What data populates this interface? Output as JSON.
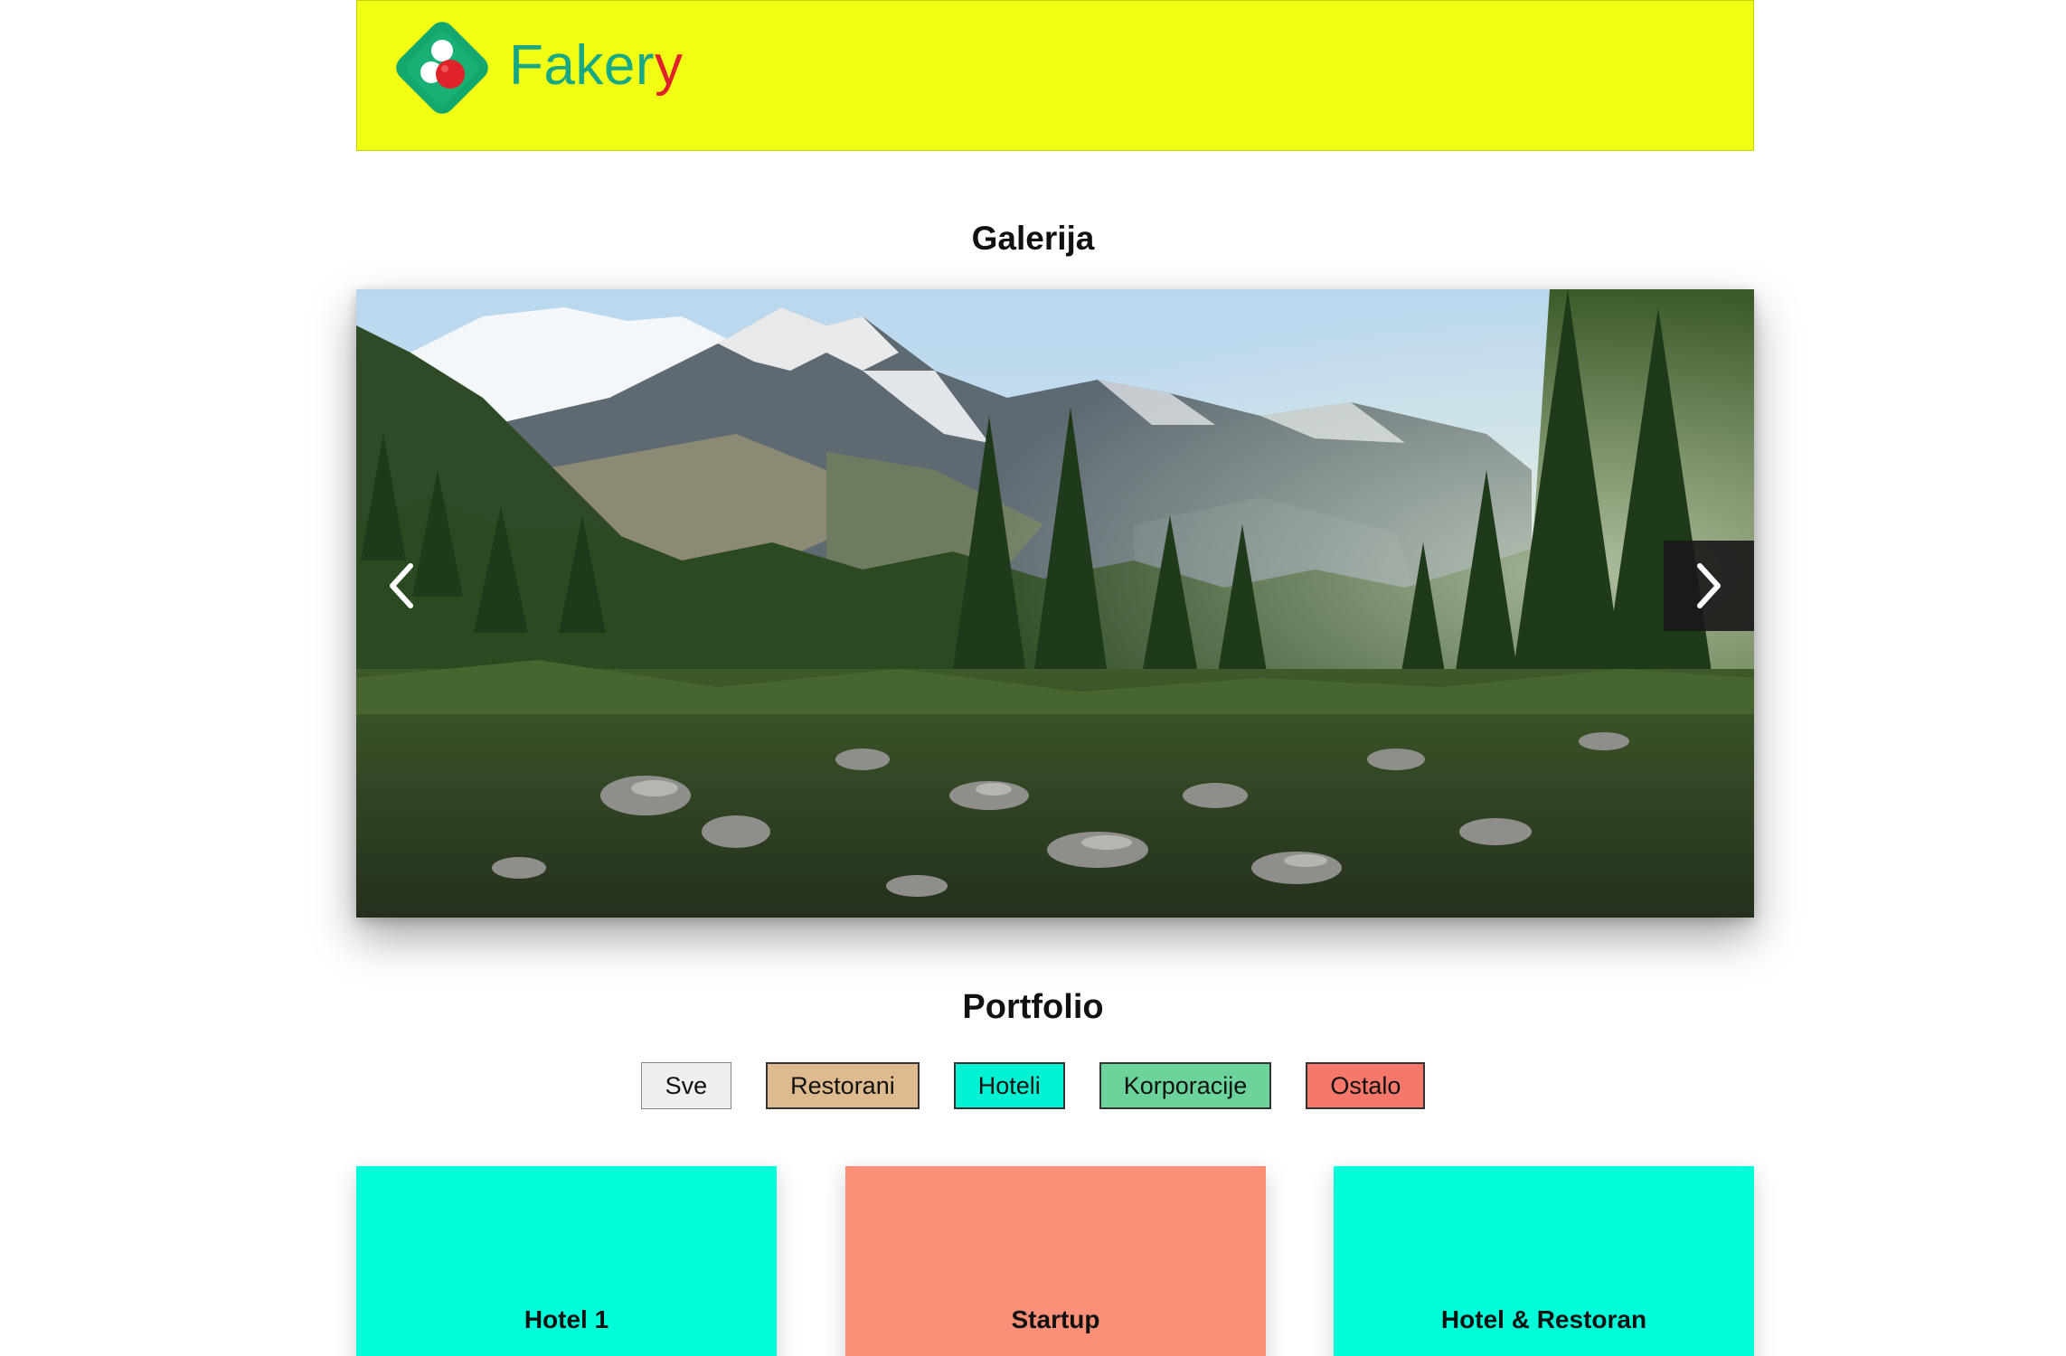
{
  "header": {
    "brand_main": "Faker",
    "brand_accent": "y",
    "colors": {
      "background": "#f1ff14",
      "brand_text": "#19a884",
      "brand_accent": "#e0232a",
      "logo_diamond": "#14a86e"
    }
  },
  "gallery": {
    "title": "Galerija",
    "prev_icon": "chevron-left-icon",
    "next_icon": "chevron-right-icon"
  },
  "portfolio": {
    "title": "Portfolio",
    "filters": [
      {
        "label": "Sve",
        "color": "#efefef"
      },
      {
        "label": "Restorani",
        "color": "#ddbb8e"
      },
      {
        "label": "Hoteli",
        "color": "#02f2d4"
      },
      {
        "label": "Korporacije",
        "color": "#6cd39a"
      },
      {
        "label": "Ostalo",
        "color": "#f6786a"
      }
    ],
    "items": [
      {
        "label": "Hotel 1",
        "color": "#00ffd8"
      },
      {
        "label": "Startup",
        "color": "#fb9078"
      },
      {
        "label": "Hotel & Restoran",
        "color": "#00ffd8"
      }
    ]
  }
}
